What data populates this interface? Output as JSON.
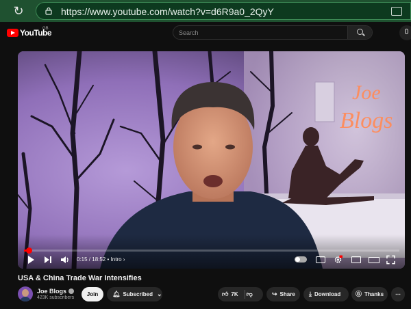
{
  "browser": {
    "url": "https://www.youtube.com/watch?v=d6R9a0_2QyY"
  },
  "header": {
    "logo_text": "YouTube",
    "region": "GB",
    "search_placeholder": "Search"
  },
  "player": {
    "time_current": "0:15",
    "time_total": "18:52",
    "time_display": "0:15 / 18:52",
    "chapter": "Intro",
    "progress_fraction": 0.0133,
    "neon_sign_line1": "Joe",
    "neon_sign_line2": "Blogs"
  },
  "video": {
    "title": "USA & China Trade War Intensifies"
  },
  "channel": {
    "name": "Joe Blogs",
    "subscribers": "423K subscribers"
  },
  "actions": {
    "join": "Join",
    "subscribed": "Subscribed",
    "likes": "7K",
    "share": "Share",
    "download": "Download",
    "thanks": "Thanks"
  },
  "colors": {
    "browser_bar": "#1f5130",
    "youtube_red": "#ff0000",
    "background": "#0f0f0f",
    "neon": "#ff7a45"
  }
}
